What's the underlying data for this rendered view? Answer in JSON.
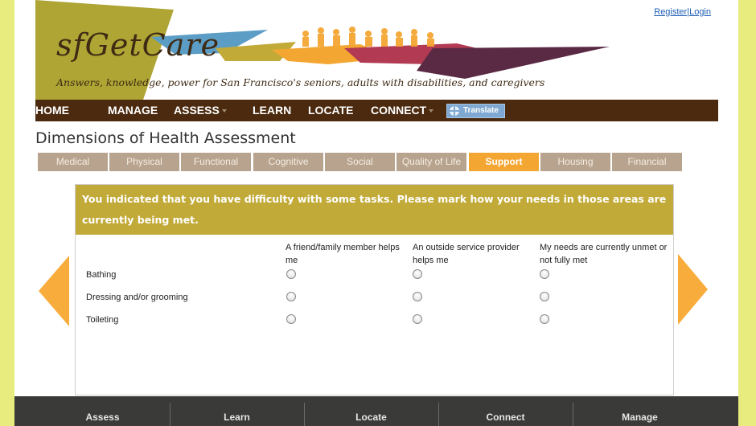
{
  "header": {
    "logo": "sfGetCare",
    "tagline": "Answers, knowledge, power for San Francisco's seniors, adults with disabilities, and caregivers",
    "register_label": "Register",
    "separator": "|",
    "login_label": "Login"
  },
  "nav": {
    "items": [
      "HOME",
      "MANAGE",
      "ASSESS",
      "LEARN",
      "LOCATE",
      "CONNECT"
    ],
    "translate_label": "Translate"
  },
  "page": {
    "title": "Dimensions of Health Assessment"
  },
  "tabs": {
    "items": [
      "Medical",
      "Physical",
      "Functional",
      "Cognitive",
      "Social",
      "Quality of Life",
      "Support",
      "Housing",
      "Financial"
    ],
    "active": "Support"
  },
  "panel": {
    "prompt": "You indicated that you have difficulty with some tasks. Please mark how your needs in those areas are currently being met.",
    "columns": [
      "A friend/family member helps me",
      "An outside service provider helps me",
      "My needs are currently unmet or not fully met"
    ],
    "rows": [
      "Bathing",
      "Dressing and/or grooming",
      "Toileting"
    ]
  },
  "footer": {
    "items": [
      "Assess",
      "Learn",
      "Locate",
      "Connect",
      "Manage"
    ]
  },
  "colors": {
    "background": "#e8eb7e",
    "nav": "#4b2a0f",
    "tab": "#b8a48e",
    "tab_active": "#f4a632",
    "panel_header": "#c2aa38",
    "arrow": "#f8ac3c",
    "footer": "#3a3a38"
  }
}
